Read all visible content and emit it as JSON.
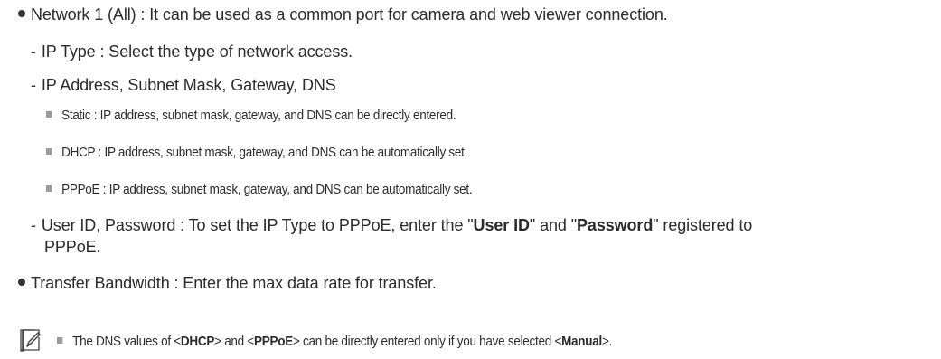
{
  "network": {
    "title": "Network 1 (All) : It can be used as a common port for camera and web viewer connection.",
    "ip_type": "IP Type : Select the type of network access.",
    "ip_address": "IP Address, Subnet Mask, Gateway, DNS",
    "static": "Static : IP address, subnet mask, gateway, and DNS can be directly entered.",
    "dhcp": "DHCP : IP address, subnet mask, gateway, and DNS can be automatically set.",
    "pppoe": "PPPoE : IP address, subnet mask, gateway, and DNS can be automatically set.",
    "user_pre": "User ID, Password : To set the IP Type to PPPoE, enter the \"",
    "user_id": "User ID",
    "user_mid": "\" and \"",
    "password": "Password",
    "user_post": "\" registered to",
    "user_cont": "PPPoE."
  },
  "bandwidth": "Transfer Bandwidth : Enter the max data rate for transfer.",
  "note": {
    "icon": "note-pencil-icon",
    "pre": "The DNS values of <",
    "dhcp": "DHCP",
    "mid1": "> and <",
    "pppoe": "PPPoE",
    "mid2": "> can be directly entered only if you have selected <",
    "manual": "Manual",
    "post": ">."
  }
}
